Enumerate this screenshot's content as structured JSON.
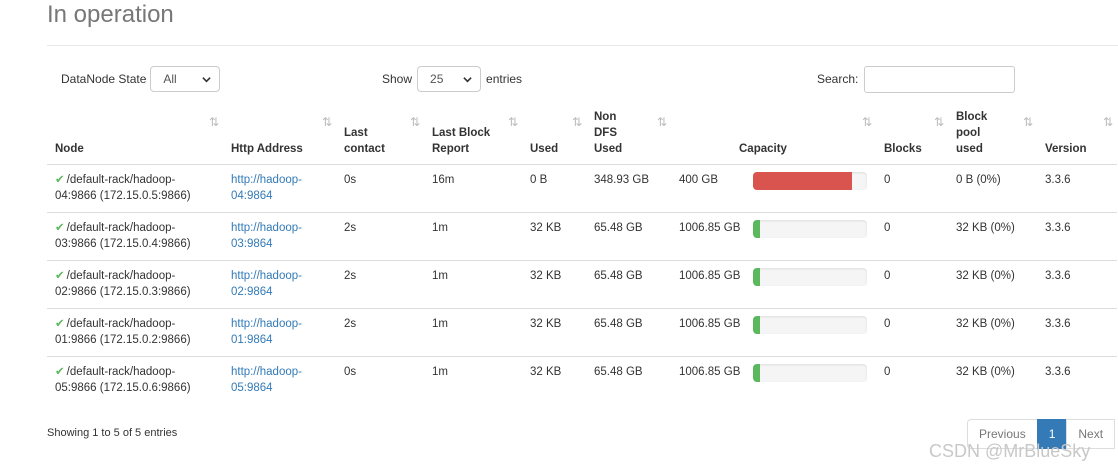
{
  "page": {
    "title": "In operation"
  },
  "filters": {
    "state_label": "DataNode State",
    "state_value": "All",
    "show_label": "Show",
    "show_value": "25",
    "entries_label": "entries",
    "search_label": "Search:",
    "search_value": ""
  },
  "table": {
    "headers": [
      {
        "key": "node",
        "label": "Node"
      },
      {
        "key": "http",
        "label": "Http Address"
      },
      {
        "key": "contact",
        "label": "Last contact"
      },
      {
        "key": "block_report",
        "label": "Last Block Report"
      },
      {
        "key": "used",
        "label": "Used"
      },
      {
        "key": "non_dfs",
        "label": "Non DFS Used"
      },
      {
        "key": "capacity",
        "label": "Capacity"
      },
      {
        "key": "blocks",
        "label": "Blocks"
      },
      {
        "key": "pool",
        "label": "Block pool used"
      },
      {
        "key": "version",
        "label": "Version"
      }
    ],
    "sort_icon": "⇅",
    "rows": [
      {
        "node": "/default-rack/hadoop-04:9866 (172.15.0.5:9866)",
        "http": "http://hadoop-04:9864",
        "contact": "0s",
        "block_report": "16m",
        "used": "0 B",
        "non_dfs": "348.93 GB",
        "capacity": "400 GB",
        "capacity_used_fraction": 0.87,
        "bar_color": "#d9534f",
        "blocks": "0",
        "pool": "0 B (0%)",
        "version": "3.3.6"
      },
      {
        "node": "/default-rack/hadoop-03:9866 (172.15.0.4:9866)",
        "http": "http://hadoop-03:9864",
        "contact": "2s",
        "block_report": "1m",
        "used": "32 KB",
        "non_dfs": "65.48 GB",
        "capacity": "1006.85 GB",
        "capacity_used_fraction": 0.065,
        "bar_color": "#5cb85c",
        "blocks": "0",
        "pool": "32 KB (0%)",
        "version": "3.3.6"
      },
      {
        "node": "/default-rack/hadoop-02:9866 (172.15.0.3:9866)",
        "http": "http://hadoop-02:9864",
        "contact": "2s",
        "block_report": "1m",
        "used": "32 KB",
        "non_dfs": "65.48 GB",
        "capacity": "1006.85 GB",
        "capacity_used_fraction": 0.065,
        "bar_color": "#5cb85c",
        "blocks": "0",
        "pool": "32 KB (0%)",
        "version": "3.3.6"
      },
      {
        "node": "/default-rack/hadoop-01:9866 (172.15.0.2:9866)",
        "http": "http://hadoop-01:9864",
        "contact": "2s",
        "block_report": "1m",
        "used": "32 KB",
        "non_dfs": "65.48 GB",
        "capacity": "1006.85 GB",
        "capacity_used_fraction": 0.065,
        "bar_color": "#5cb85c",
        "blocks": "0",
        "pool": "32 KB (0%)",
        "version": "3.3.6"
      },
      {
        "node": "/default-rack/hadoop-05:9866 (172.15.0.6:9866)",
        "http": "http://hadoop-05:9864",
        "contact": "0s",
        "block_report": "1m",
        "used": "32 KB",
        "non_dfs": "65.48 GB",
        "capacity": "1006.85 GB",
        "capacity_used_fraction": 0.065,
        "bar_color": "#5cb85c",
        "blocks": "0",
        "pool": "32 KB (0%)",
        "version": "3.3.6"
      }
    ]
  },
  "footer": {
    "info": "Showing 1 to 5 of 5 entries",
    "prev": "Previous",
    "page": "1",
    "next": "Next",
    "watermark": "CSDN @MrBlueSky"
  },
  "icons": {
    "check": "✔",
    "state": "check-icon"
  }
}
